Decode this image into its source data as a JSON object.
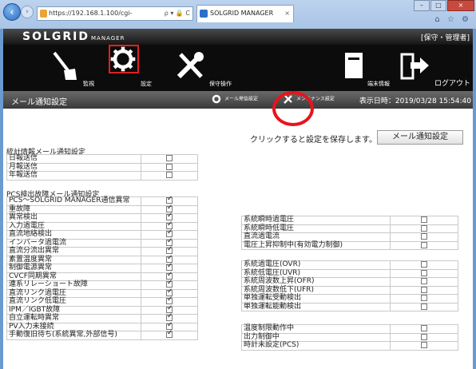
{
  "browser": {
    "url": "https://192.168.1.100/cgi-",
    "url_controls": "ρ ▾ 🔒 C",
    "tab_title": "SOLGRID MANAGER",
    "tab_close": "×",
    "win_min": "–",
    "win_max": "□",
    "win_close": "×",
    "right_icons": "⌂ ☆ ⚙"
  },
  "app": {
    "brand": "SOLGRID",
    "brand_sub": "MANAGER",
    "role": "[保守・管理者]",
    "menu": [
      {
        "label": "監視",
        "icon": "broom-icon"
      },
      {
        "label": "設定",
        "icon": "gear-icon"
      },
      {
        "label": "保守操作",
        "icon": "tools-icon"
      },
      {
        "label": "端末情報",
        "icon": "terminal-icon"
      },
      {
        "label": "ログアウト",
        "icon": "logout-icon"
      }
    ]
  },
  "subbar": {
    "title": "メール通知設定",
    "btn_mail": "メール発信設定",
    "btn_maint": "メンテナンス設定",
    "display_time": "表示日時：2019/03/28 15:54:40"
  },
  "save": {
    "note": "クリックすると設定を保存します。",
    "button": "メール通知設定"
  },
  "stats": {
    "title": "統計情報メール通知設定",
    "rows": [
      {
        "label": "日報送信",
        "checked": false
      },
      {
        "label": "月報送信",
        "checked": false
      },
      {
        "label": "年報送信",
        "checked": false
      }
    ]
  },
  "pcs": {
    "title": "PCS検出故障メール通知設定",
    "left_rows": [
      {
        "label": "PCS～SOLGRID MANAGER通信異常",
        "checked": true
      },
      {
        "label": "重故障",
        "checked": true
      },
      {
        "label": "異常検出",
        "checked": true
      },
      {
        "label": "入力過電圧",
        "checked": true
      },
      {
        "label": "直流地絡検出",
        "checked": true
      },
      {
        "label": "インバータ過電流",
        "checked": true
      },
      {
        "label": "直流分流出異常",
        "checked": true
      },
      {
        "label": "素置温度異常",
        "checked": true
      },
      {
        "label": "制御電源異常",
        "checked": true
      },
      {
        "label": "CVCF同期異常",
        "checked": true
      },
      {
        "label": "連系リレーショート故障",
        "checked": true
      },
      {
        "label": "直流リンク過電圧",
        "checked": true
      },
      {
        "label": "直流リンク低電圧",
        "checked": true
      },
      {
        "label": "IPM／IGBT故障",
        "checked": true
      },
      {
        "label": "自立運転時異常",
        "checked": true
      },
      {
        "label": "PV入力未接続",
        "checked": true
      },
      {
        "label": "手動復旧待ち(系統異常,外部信号)",
        "checked": true
      }
    ],
    "right_group1": [
      {
        "label": "系統瞬時過電圧",
        "checked": false
      },
      {
        "label": "系統瞬時低電圧",
        "checked": false
      },
      {
        "label": "直流過電流",
        "checked": false
      },
      {
        "label": "電圧上昇抑制中(有効電力制御)",
        "checked": false
      }
    ],
    "right_group2": [
      {
        "label": "系統過電圧(OVR)",
        "checked": false
      },
      {
        "label": "系統低電圧(UVR)",
        "checked": false
      },
      {
        "label": "系統周波数上昇(OFR)",
        "checked": false
      },
      {
        "label": "系統周波数低下(UFR)",
        "checked": false
      },
      {
        "label": "単独運転受動検出",
        "checked": false
      },
      {
        "label": "単独運転能動検出",
        "checked": false
      }
    ],
    "right_group3": [
      {
        "label": "温度制限動作中",
        "checked": false
      },
      {
        "label": "出力制御中",
        "checked": false
      },
      {
        "label": "時計未設定(PCS)",
        "checked": false
      }
    ]
  }
}
